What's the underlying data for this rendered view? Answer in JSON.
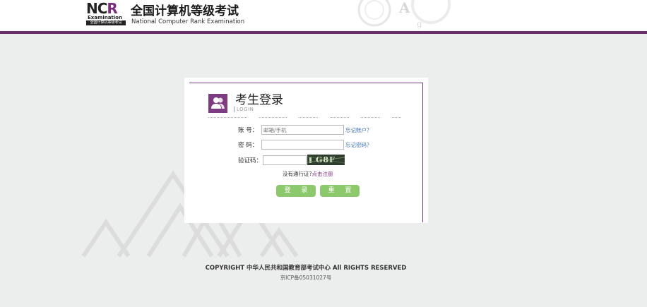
{
  "header": {
    "logo_text_n": "NC",
    "logo_text_r": "R",
    "logo_examination": "Examination",
    "logo_strip": "全国计算机等级考试",
    "brand_cn": "全国计算机等级考试",
    "brand_en": "National Computer Rank Examination"
  },
  "login": {
    "title": "考生登录",
    "subtitle": "LOGIN",
    "account_label": "账  号：",
    "account_placeholder": "邮箱/手机",
    "forgot_account": "忘记账户？",
    "password_label": "密  码：",
    "password_value": "",
    "forgot_password": "忘记密码？",
    "captcha_label": "验证码：",
    "captcha_value": "",
    "captcha_image_text": "G8F",
    "no_account_text": "没有通行证?",
    "register_link": "点击注册",
    "login_button": "登 录",
    "reset_button": "重 置"
  },
  "footer": {
    "copyright": "COPYRIGHT 中华人民共和国教育部考试中心 All RIGHTS RESERVED",
    "icp": "京ICP备05031027号"
  },
  "colors": {
    "brand_purple": "#6a2e6b",
    "button_green": "#8cc96c",
    "link_blue": "#3a6fb0",
    "background": "#eceded"
  },
  "icons": [
    "user-group-icon",
    "captcha-image"
  ]
}
